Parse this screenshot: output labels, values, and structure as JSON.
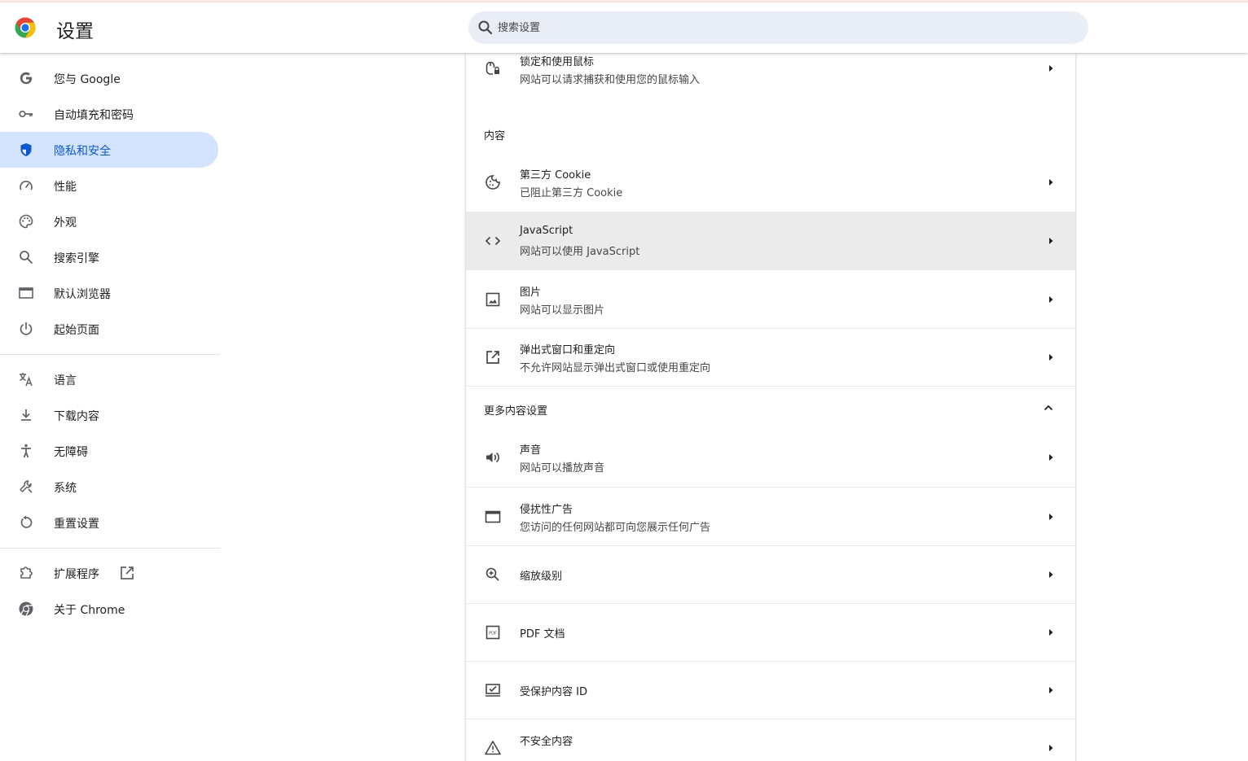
{
  "header": {
    "title": "设置",
    "search_placeholder": "搜索设置",
    "search_value": ""
  },
  "colors": {
    "accent": "#0b57d0",
    "active_nav_bg": "#d3e3fd",
    "search_bg": "#e9eef6"
  },
  "sidebar": {
    "items": [
      {
        "label": "您与 Google",
        "icon": "google-g-icon"
      },
      {
        "label": "自动填充和密码",
        "icon": "key-icon"
      },
      {
        "label": "隐私和安全",
        "icon": "shield-icon",
        "active": true
      },
      {
        "label": "性能",
        "icon": "speedometer-icon"
      },
      {
        "label": "外观",
        "icon": "palette-icon"
      },
      {
        "label": "搜索引擎",
        "icon": "search-icon"
      },
      {
        "label": "默认浏览器",
        "icon": "browser-window-icon"
      },
      {
        "label": "起始页面",
        "icon": "power-icon"
      },
      {
        "label": "语言",
        "icon": "translate-icon"
      },
      {
        "label": "下载内容",
        "icon": "download-icon"
      },
      {
        "label": "无障碍",
        "icon": "accessibility-icon"
      },
      {
        "label": "系统",
        "icon": "wrench-icon"
      },
      {
        "label": "重置设置",
        "icon": "reset-icon"
      },
      {
        "label": "扩展程序",
        "icon": "puzzle-icon"
      },
      {
        "label": "关于 Chrome",
        "icon": "chrome-icon"
      }
    ]
  },
  "content": {
    "mouse_lock": {
      "title": "锁定和使用鼠标",
      "subtitle": "网站可以请求捕获和使用您的鼠标输入"
    },
    "section_content": "内容",
    "third_party_cookie": {
      "title": "第三方 Cookie",
      "subtitle": "已阻止第三方 Cookie"
    },
    "javascript": {
      "title": "JavaScript",
      "subtitle": "网站可以使用 JavaScript"
    },
    "images": {
      "title": "图片",
      "subtitle": "网站可以显示图片"
    },
    "popups": {
      "title": "弹出式窗口和重定向",
      "subtitle": "不允许网站显示弹出式窗口或使用重定向"
    },
    "more_content_settings": "更多内容设置",
    "sound": {
      "title": "声音",
      "subtitle": "网站可以播放声音"
    },
    "intrusive_ads": {
      "title": "侵扰性广告",
      "subtitle": "您访问的任何网站都可向您展示任何广告"
    },
    "zoom": {
      "title": "缩放级别"
    },
    "pdf": {
      "title": "PDF 文档"
    },
    "protected_content": {
      "title": "受保护内容 ID"
    },
    "insecure_content": {
      "title": "不安全内容"
    }
  }
}
